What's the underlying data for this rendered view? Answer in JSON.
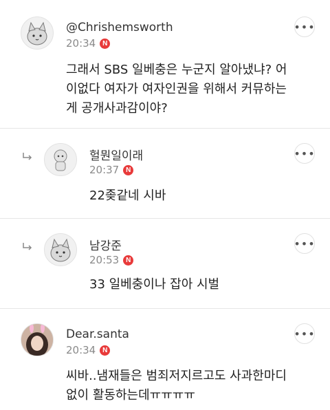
{
  "comments": [
    {
      "author": "@Chrishemsworth",
      "time": "20:34",
      "badge": "N",
      "text_lines": [
        "그래서 SBS 일베충은 누군지 알아냈냐? 어",
        "이없다 여자가 여자인권을 위해서 커뮤하는",
        "게 공개사과감이야?"
      ],
      "avatar_icon": "cat-icon"
    },
    {
      "author": "헐뭔일이래",
      "time": "20:37",
      "badge": "N",
      "text_lines": [
        "22좆같네 시바"
      ],
      "avatar_icon": "doll-icon",
      "is_reply": true
    },
    {
      "author": "남강준",
      "time": "20:53",
      "badge": "N",
      "text_lines": [
        "33 일베충이나 잡아 시벌"
      ],
      "avatar_icon": "cat-icon",
      "is_reply": true
    },
    {
      "author": "Dear.santa",
      "time": "20:34",
      "badge": "N",
      "text_lines": [
        "씨바..냄재들은 범죄저지르고도 사과한마디",
        "없이 활동하는데ㅠㅠㅠㅠ"
      ],
      "avatar_icon": "photo-avatar-icon"
    }
  ],
  "more_label": "•••",
  "colors": {
    "badge": "#e83a3a",
    "divider": "#e6e6e6",
    "meta": "#8a8a8a"
  }
}
